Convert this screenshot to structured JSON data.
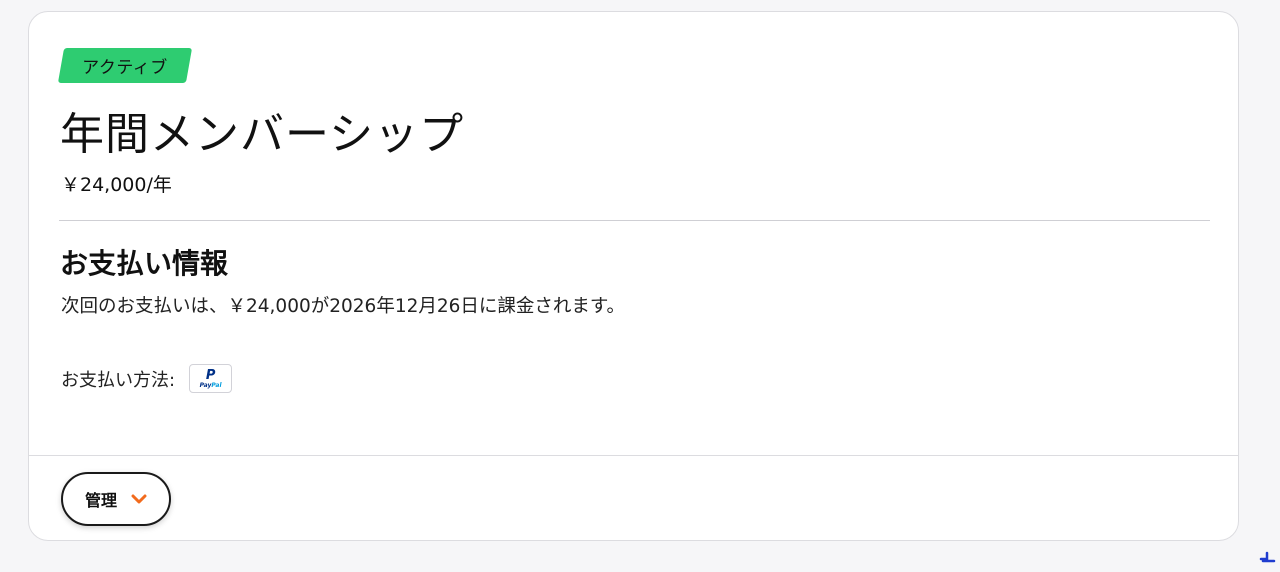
{
  "membership": {
    "status_badge": "アクティブ",
    "title": "年間メンバーシップ",
    "price": "￥24,000/年"
  },
  "payment_info": {
    "heading": "お支払い情報",
    "next_payment_text": "次回のお支払いは、￥24,000が2026年12月26日に課金されます。",
    "method_label": "お支払い方法:",
    "method_icon": "paypal-icon"
  },
  "actions": {
    "manage_label": "管理",
    "manage_icon": "chevron-down-icon"
  },
  "colors": {
    "badge": "#2ecc71",
    "accent": "#f26b1d",
    "paypal_dark": "#003087",
    "paypal_light": "#009cde"
  }
}
